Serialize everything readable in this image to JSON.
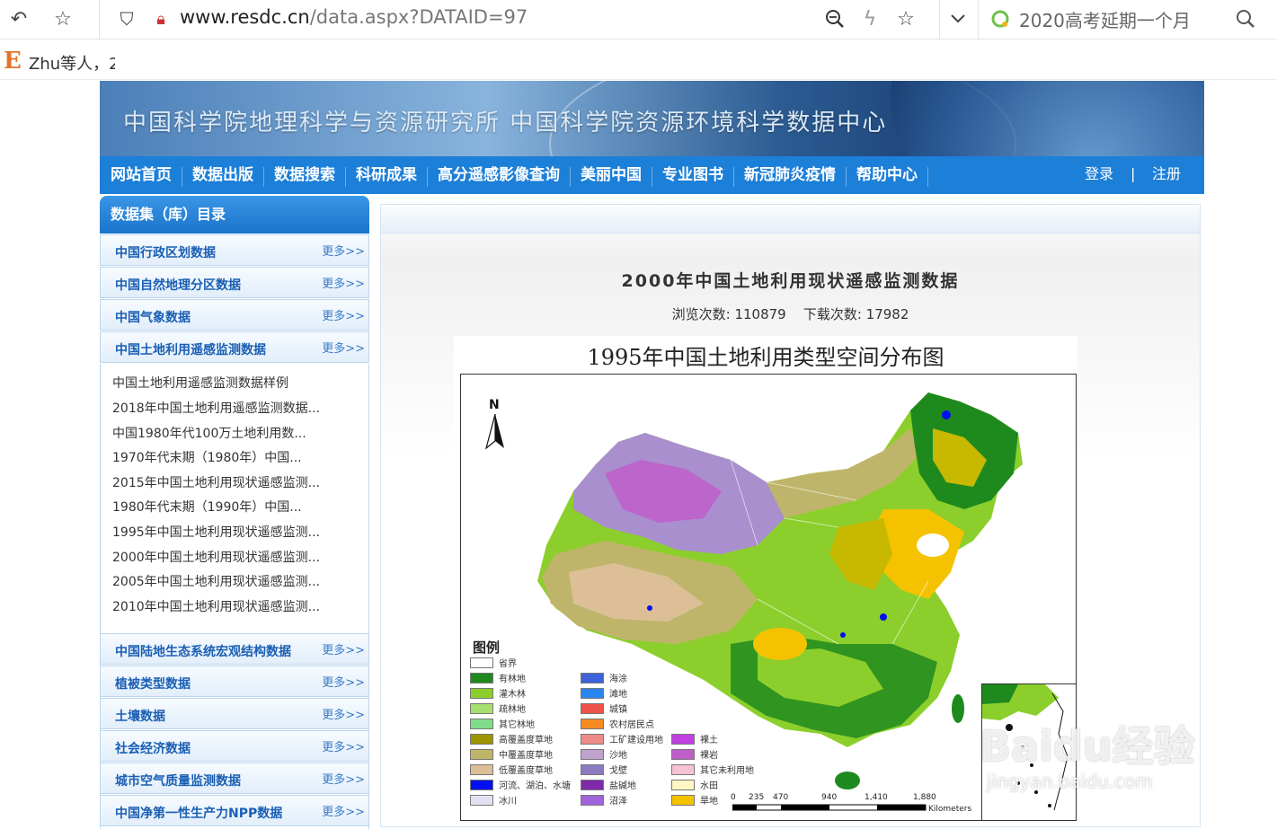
{
  "browser": {
    "url_host": "www.resdc.cn",
    "url_path": "/data.aspx?DATAID=97",
    "search_hint": "2020高考延期一个月",
    "bookmark_label": "Zhu等人，2"
  },
  "site": {
    "banner_title": "中国科学院地理科学与资源研究所 中国科学院资源环境科学数据中心",
    "nav": [
      "网站首页",
      "数据出版",
      "数据搜索",
      "科研成果",
      "高分遥感影像查询",
      "美丽中国",
      "专业图书",
      "新冠肺炎疫情",
      "帮助中心"
    ],
    "login": "登录",
    "login_sep": "|",
    "register": "注册"
  },
  "sidebar": {
    "heading": "数据集（库）目录",
    "more_label": "更多>>",
    "categories_top": [
      "中国行政区划数据",
      "中国自然地理分区数据",
      "中国气象数据",
      "中国土地利用遥感监测数据"
    ],
    "subitems": [
      "中国土地利用遥感监测数据样例",
      "2018年中国土地利用遥感监测数据...",
      "中国1980年代100万土地利用数...",
      "1970年代末期（1980年）中国...",
      "2015年中国土地利用现状遥感监测...",
      "1980年代末期（1990年）中国...",
      "1995年中国土地利用现状遥感监测...",
      "2000年中国土地利用现状遥感监测...",
      "2005年中国土地利用现状遥感监测...",
      "2010年中国土地利用现状遥感监测..."
    ],
    "categories_bottom": [
      "中国陆地生态系统宏观结构数据",
      "植被类型数据",
      "土壤数据",
      "社会经济数据",
      "城市空气质量监测数据",
      "中国净第一性生产力NPP数据"
    ]
  },
  "main": {
    "title": "2000年中国土地利用现状遥感监测数据",
    "views_label": "浏览次数:",
    "views": "110879",
    "downloads_label": "下载次数:",
    "downloads": "17982"
  },
  "map": {
    "title": "1995年中国土地利用类型空间分布图",
    "north": "N",
    "legend_title": "图例",
    "legend": [
      {
        "label": "省界",
        "color": "#ffffff"
      },
      {
        "label": "有林地",
        "color": "#1e8a1e"
      },
      {
        "label": "灌木林",
        "color": "#8ccf2c"
      },
      {
        "label": "疏林地",
        "color": "#a8e070"
      },
      {
        "label": "其它林地",
        "color": "#7fdc8a"
      },
      {
        "label": "高覆盖度草地",
        "color": "#9c9400"
      },
      {
        "label": "中覆盖度草地",
        "color": "#bfb56a"
      },
      {
        "label": "低覆盖度草地",
        "color": "#dcbf96"
      },
      {
        "label": "河流、湖泊、水塘",
        "color": "#0010ee"
      },
      {
        "label": "冰川",
        "color": "#e4e0f4"
      },
      {
        "label": "海涂",
        "color": "#3d62d9"
      },
      {
        "label": "滩地",
        "color": "#2a86f0"
      },
      {
        "label": "城镇",
        "color": "#f0534a"
      },
      {
        "label": "农村居民点",
        "color": "#f58a22"
      },
      {
        "label": "工矿建设用地",
        "color": "#ee8c8a"
      },
      {
        "label": "沙地",
        "color": "#bfa3cc"
      },
      {
        "label": "戈壁",
        "color": "#8c7bc3"
      },
      {
        "label": "盐碱地",
        "color": "#7d2aa9"
      },
      {
        "label": "沼泽",
        "color": "#9f64d9"
      },
      {
        "label": "裸土",
        "color": "#c040e0"
      },
      {
        "label": "裸岩",
        "color": "#c05ec9"
      },
      {
        "label": "其它未利用地",
        "color": "#f7c2d6"
      },
      {
        "label": "水田",
        "color": "#fff7c4"
      },
      {
        "label": "旱地",
        "color": "#f5c200"
      }
    ],
    "scale_ticks": [
      "0",
      "235",
      "470",
      "940",
      "1,410",
      "1,880"
    ],
    "scale_unit": "Kilometers"
  },
  "watermark": {
    "text": "Baidu经验",
    "url": "jingyan.baidu.com"
  }
}
